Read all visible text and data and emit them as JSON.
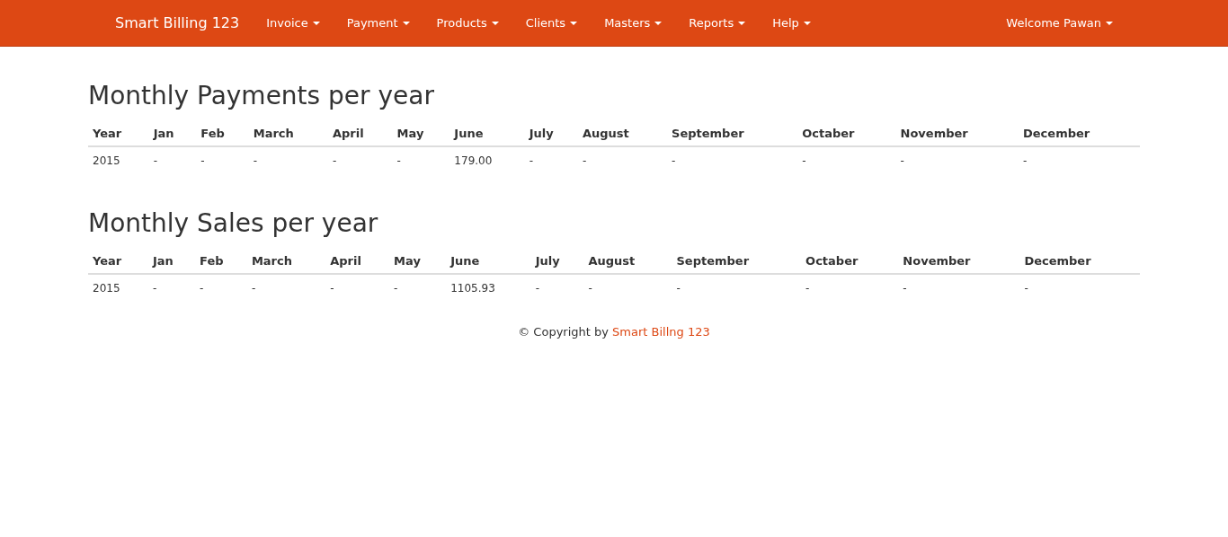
{
  "navbar": {
    "brand": "Smart Billing 123",
    "menus": [
      {
        "label": "Invoice"
      },
      {
        "label": "Payment"
      },
      {
        "label": "Products"
      },
      {
        "label": "Clients"
      },
      {
        "label": "Masters"
      },
      {
        "label": "Reports"
      },
      {
        "label": "Help"
      }
    ],
    "user_menu": {
      "label": "Welcome Pawan"
    }
  },
  "sections": [
    {
      "title": "Monthly Payments per year",
      "columns": [
        "Year",
        "Jan",
        "Feb",
        "March",
        "April",
        "May",
        "June",
        "July",
        "August",
        "September",
        "Octaber",
        "November",
        "December"
      ],
      "rows": [
        [
          "2015",
          "-",
          "-",
          "-",
          "-",
          "-",
          "179.00",
          "-",
          "-",
          "-",
          "-",
          "-",
          "-"
        ]
      ]
    },
    {
      "title": "Monthly Sales per year",
      "columns": [
        "Year",
        "Jan",
        "Feb",
        "March",
        "April",
        "May",
        "June",
        "July",
        "August",
        "September",
        "Octaber",
        "November",
        "December"
      ],
      "rows": [
        [
          "2015",
          "-",
          "-",
          "-",
          "-",
          "-",
          "1105.93",
          "-",
          "-",
          "-",
          "-",
          "-",
          "-"
        ]
      ]
    }
  ],
  "footer": {
    "text": "© Copyright by",
    "link": "Smart Billng 123"
  }
}
